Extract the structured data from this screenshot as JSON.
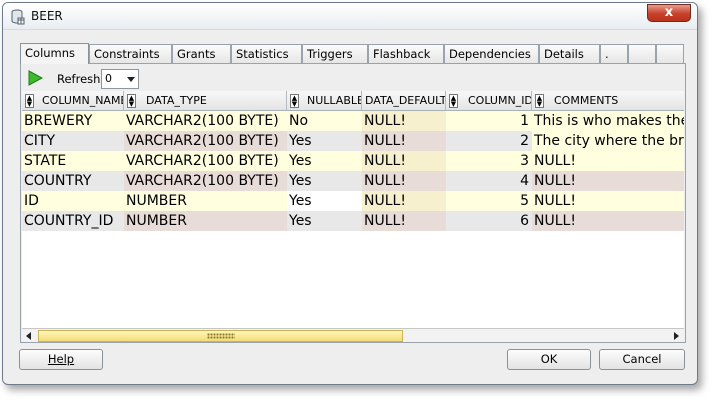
{
  "window": {
    "title": "BEER",
    "close_glyph": "x",
    "icon": "database-table-icon"
  },
  "tabs": [
    {
      "label": "Columns",
      "active": true
    },
    {
      "label": "Constraints"
    },
    {
      "label": "Grants"
    },
    {
      "label": "Statistics"
    },
    {
      "label": "Triggers"
    },
    {
      "label": "Flashback"
    },
    {
      "label": "Dependencies"
    },
    {
      "label": "Details"
    },
    {
      "label": "."
    },
    {
      "label": ""
    },
    {
      "label": ""
    }
  ],
  "toolbar": {
    "run_icon": "green-play-icon",
    "refresh_label": "Refresh:",
    "refresh_value": "0"
  },
  "grid": {
    "headers": [
      "COLUMN_NAME",
      "DATA_TYPE",
      "NULLABLE",
      "DATA_DEFAULT",
      "COLUMN_ID",
      "COMMENTS"
    ],
    "rows": [
      [
        "BREWERY",
        "VARCHAR2(100 BYTE)",
        "No",
        "NULL!",
        "1",
        "This is who makes the"
      ],
      [
        "CITY",
        "VARCHAR2(100 BYTE)",
        "Yes",
        "NULL!",
        "2",
        "The city where the br"
      ],
      [
        "STATE",
        "VARCHAR2(100 BYTE)",
        "Yes",
        "NULL!",
        "3",
        "NULL!"
      ],
      [
        "COUNTRY",
        "VARCHAR2(100 BYTE)",
        "Yes",
        "NULL!",
        "4",
        "NULL!"
      ],
      [
        "ID",
        "NUMBER",
        "Yes",
        "NULL!",
        "5",
        "NULL!"
      ],
      [
        "COUNTRY_ID",
        "NUMBER",
        "Yes",
        "NULL!",
        "6",
        "NULL!"
      ]
    ],
    "colors": {
      "row_yellow": "#ffffe0",
      "row_grey": "#e8e8e8",
      "cell_pink": "#e8dcd8",
      "cell_pink_light": "#f4ece8"
    }
  },
  "buttons": {
    "help": "Help",
    "ok": "OK",
    "cancel": "Cancel"
  }
}
